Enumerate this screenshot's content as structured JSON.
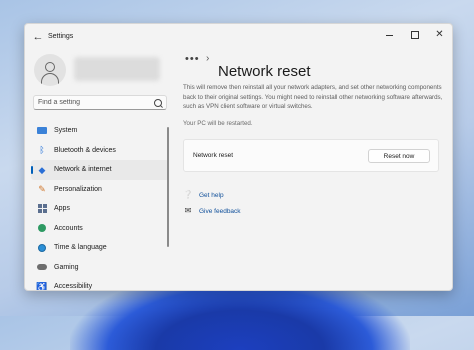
{
  "window": {
    "title": "Settings"
  },
  "search": {
    "placeholder": "Find a setting"
  },
  "sidebar": {
    "items": [
      {
        "label": "System",
        "icon": "display-icon"
      },
      {
        "label": "Bluetooth & devices",
        "icon": "bluetooth-icon"
      },
      {
        "label": "Network & internet",
        "icon": "wifi-icon",
        "selected": true
      },
      {
        "label": "Personalization",
        "icon": "brush-icon"
      },
      {
        "label": "Apps",
        "icon": "apps-icon"
      },
      {
        "label": "Accounts",
        "icon": "person-icon"
      },
      {
        "label": "Time & language",
        "icon": "globe-clock-icon"
      },
      {
        "label": "Gaming",
        "icon": "gamepad-icon"
      },
      {
        "label": "Accessibility",
        "icon": "accessibility-icon"
      }
    ]
  },
  "breadcrumb": {
    "more": "•••",
    "separator": "›",
    "title": "Network reset"
  },
  "main": {
    "description": "This will remove then reinstall all your network adapters, and set other networking components back to their original settings. You might need to reinstall other networking software afterwards, such as VPN client software or virtual switches.",
    "restart_note": "Your PC will be restarted.",
    "reset_card": {
      "label": "Network reset",
      "button": "Reset now"
    },
    "links": {
      "help": "Get help",
      "feedback": "Give feedback"
    }
  },
  "colors": {
    "accent": "#005fb8",
    "link": "#0f4f9a"
  }
}
